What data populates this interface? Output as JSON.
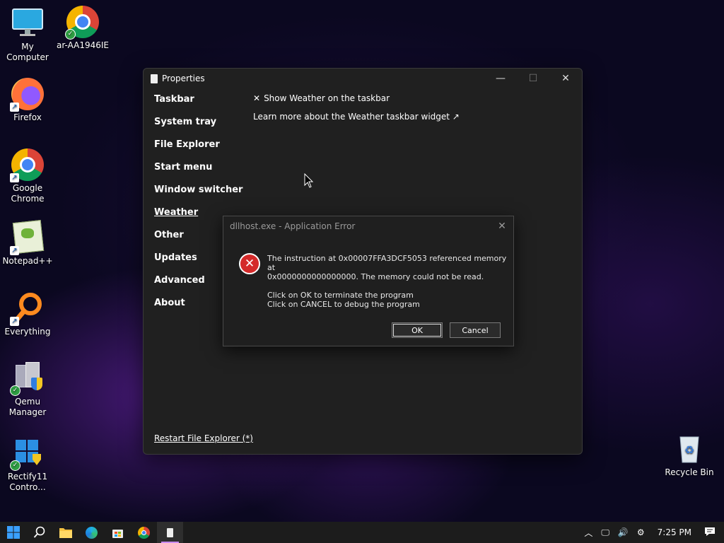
{
  "desktop_icons": [
    {
      "label": "My Computer",
      "icon": "monitor-icon"
    },
    {
      "label": "ar-AA1946IE",
      "icon": "chrome-icon"
    },
    {
      "label": "Firefox",
      "icon": "firefox-icon"
    },
    {
      "label": "Google Chrome",
      "icon": "chrome-icon"
    },
    {
      "label": "Notepad++",
      "icon": "notepadpp-icon"
    },
    {
      "label": "Everything",
      "icon": "search-icon"
    },
    {
      "label": "Qemu Manager",
      "icon": "qemu-icon"
    },
    {
      "label": "Rectify11 Contro...",
      "icon": "windows-icon"
    },
    {
      "label": "Recycle Bin",
      "icon": "recycle-bin-icon"
    }
  ],
  "properties_window": {
    "title": "Properties",
    "nav": [
      "Taskbar",
      "System tray",
      "File Explorer",
      "Start menu",
      "Window switcher",
      "Weather",
      "Other",
      "Updates",
      "Advanced",
      "About"
    ],
    "active_nav": "Weather",
    "options": {
      "show_weather_mark": "✕",
      "show_weather": "Show Weather on the taskbar",
      "learn_more": "Learn more about the Weather taskbar widget ↗"
    },
    "restart_link": "Restart File Explorer (*)"
  },
  "error_dialog": {
    "title": "dllhost.exe - Application Error",
    "line1": "The instruction at 0x00007FFA3DCF5053 referenced memory at",
    "line2": "0x0000000000000000. The memory could not be read.",
    "line3": "Click on OK to terminate the program",
    "line4": "Click on CANCEL to debug the program",
    "ok_label": "OK",
    "cancel_label": "Cancel"
  },
  "taskbar": {
    "time": "7:25 PM",
    "accent": "#c98bf0"
  }
}
